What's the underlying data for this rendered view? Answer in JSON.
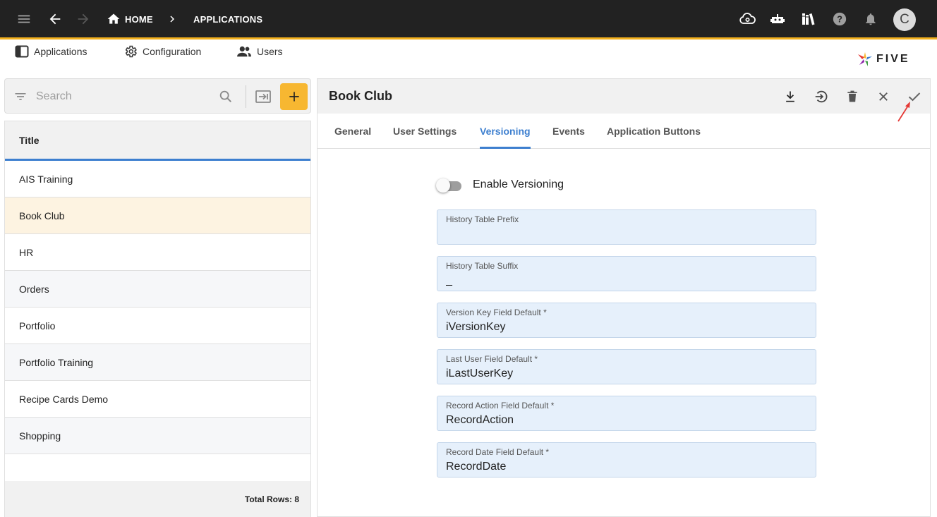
{
  "topbar": {
    "breadcrumb_home": "HOME",
    "breadcrumb_current": "APPLICATIONS",
    "avatar_initial": "C",
    "bg_color": "#222222",
    "accent_color": "#f2b01e"
  },
  "menu": {
    "items": [
      {
        "label": "Applications",
        "icon": "applications-icon"
      },
      {
        "label": "Configuration",
        "icon": "configuration-icon"
      },
      {
        "label": "Users",
        "icon": "users-icon"
      }
    ],
    "logo_text": "FIVE"
  },
  "search": {
    "placeholder": "Search"
  },
  "list": {
    "column_header": "Title",
    "rows": [
      {
        "title": "AIS Training"
      },
      {
        "title": "Book Club",
        "selected": true
      },
      {
        "title": "HR"
      },
      {
        "title": "Orders"
      },
      {
        "title": "Portfolio"
      },
      {
        "title": "Portfolio Training"
      },
      {
        "title": "Recipe Cards Demo"
      },
      {
        "title": "Shopping"
      }
    ],
    "footer": "Total Rows: 8"
  },
  "detail": {
    "title": "Book Club",
    "tabs": [
      "General",
      "User Settings",
      "Versioning",
      "Events",
      "Application Buttons"
    ],
    "active_tab": "Versioning",
    "toggle": {
      "label": "Enable Versioning",
      "on": false
    },
    "fields": [
      {
        "label": "History Table Prefix",
        "value": ""
      },
      {
        "label": "History Table Suffix",
        "value": "_"
      },
      {
        "label": "Version Key Field Default *",
        "value": "iVersionKey"
      },
      {
        "label": "Last User Field Default *",
        "value": "iLastUserKey"
      },
      {
        "label": "Record Action Field Default *",
        "value": "RecordAction"
      },
      {
        "label": "Record Date Field Default *",
        "value": "RecordDate"
      }
    ]
  },
  "colors": {
    "accent_blue": "#3d7fcf",
    "add_button": "#f7b731",
    "selected_row": "#fdf3e1",
    "field_bg": "#e6f0fb",
    "annotation_arrow": "#e53935"
  }
}
